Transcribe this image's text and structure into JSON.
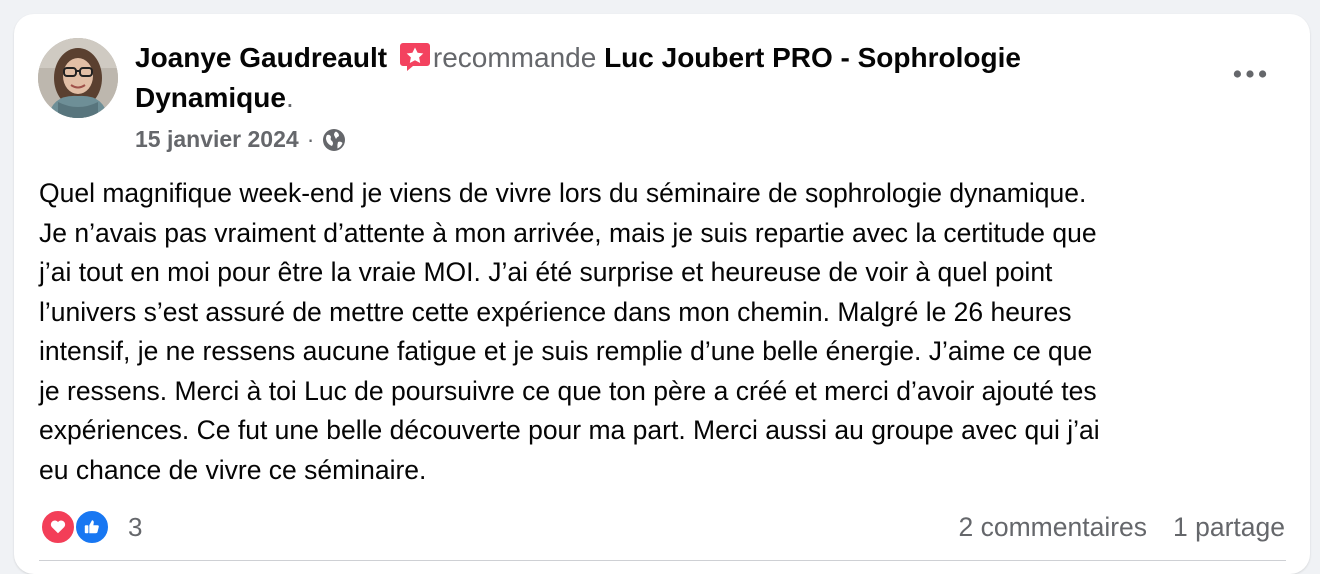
{
  "post": {
    "author_name": "Joanye Gaudreault",
    "recommends_word": "recommande",
    "page_name": "Luc Joubert PRO - Sophrologie Dynamique",
    "end_punct": ".",
    "date": "15 janvier 2024",
    "separator": "·",
    "privacy_icon": "globe-icon",
    "more_icon": "more-options-icon",
    "body": "Quel magnifique week-end je viens de vivre lors du séminaire de sophrologie dynamique.\nJe n’avais pas vraiment d’attente à mon arrivée, mais je suis repartie avec la certitude que\nj’ai tout en moi pour être la vraie MOI. J’ai été surprise et heureuse de voir à quel point\nl’univers s’est assuré de mettre cette expérience dans mon chemin. Malgré le 26 heures\nintensif, je ne ressens aucune fatigue et je suis remplie d’une belle énergie. J’aime ce que\nje ressens. Merci à toi Luc de poursuivre ce que ton père a créé et merci d’avoir ajouté tes\nexpériences. Ce fut une belle découverte pour ma part. Merci aussi au groupe avec qui j’ai\neu chance de vivre ce séminaire."
  },
  "footer": {
    "reaction_icons": [
      "love-icon",
      "like-icon"
    ],
    "reaction_count": "3",
    "comments_label": "2 commentaires",
    "shares_label": "1 partage"
  },
  "colors": {
    "card_bg": "#ffffff",
    "page_bg": "#f0f2f5",
    "secondary_text": "#65676b",
    "recommend_badge": "#f3425f",
    "love_red": "#f33e58",
    "like_blue": "#1877f2"
  }
}
